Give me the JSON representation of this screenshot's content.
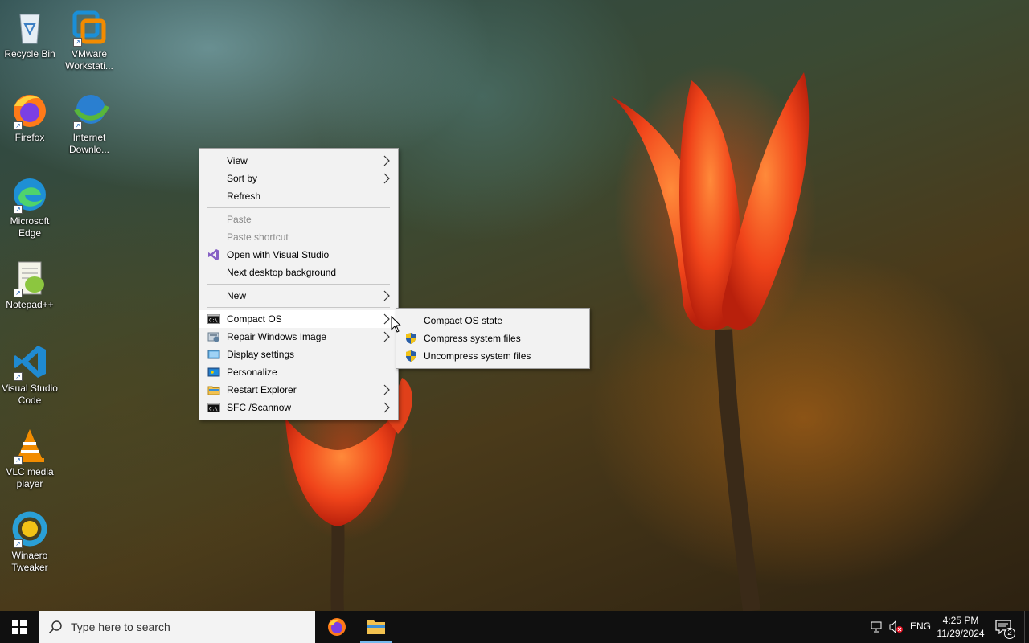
{
  "desktop": {
    "icons": [
      {
        "label": "Recycle Bin",
        "icon": "recycle-bin-icon"
      },
      {
        "label": "VMware Workstati...",
        "icon": "vmware-icon"
      },
      {
        "label": "Firefox",
        "icon": "firefox-icon"
      },
      {
        "label": "Internet Downlo...",
        "icon": "internet-download-manager-icon"
      },
      {
        "label": "Microsoft Edge",
        "icon": "edge-icon"
      },
      {
        "label": "Notepad++",
        "icon": "notepad-plus-plus-icon"
      },
      {
        "label": "Visual Studio Code",
        "icon": "vscode-icon"
      },
      {
        "label": "VLC media player",
        "icon": "vlc-icon"
      },
      {
        "label": "Winaero Tweaker",
        "icon": "winaero-tweaker-icon"
      }
    ]
  },
  "context_menu": {
    "items": [
      {
        "label": "View",
        "submenu": true
      },
      {
        "label": "Sort by",
        "submenu": true
      },
      {
        "label": "Refresh"
      },
      {
        "label": "Paste",
        "disabled": true
      },
      {
        "label": "Paste shortcut",
        "disabled": true
      },
      {
        "label": "Open with Visual Studio",
        "icon": "visual-studio-icon"
      },
      {
        "label": "Next desktop background"
      },
      {
        "label": "New",
        "submenu": true
      },
      {
        "label": "Compact OS",
        "icon": "console-icon",
        "submenu": true,
        "highlighted": true
      },
      {
        "label": "Repair Windows Image",
        "icon": "repair-icon",
        "submenu": true
      },
      {
        "label": "Display settings",
        "icon": "display-icon"
      },
      {
        "label": "Personalize",
        "icon": "personalize-icon"
      },
      {
        "label": "Restart Explorer",
        "icon": "folder-icon",
        "submenu": true
      },
      {
        "label": "SFC /Scannow",
        "icon": "console-icon",
        "submenu": true
      }
    ]
  },
  "submenu": {
    "items": [
      {
        "label": "Compact OS state"
      },
      {
        "label": "Compress system files",
        "icon": "uac-shield-icon"
      },
      {
        "label": "Uncompress system files",
        "icon": "uac-shield-icon"
      }
    ]
  },
  "taskbar": {
    "search_placeholder": "Type here to search",
    "pinned": [
      {
        "name": "Firefox",
        "icon": "firefox-icon"
      },
      {
        "name": "File Explorer",
        "icon": "file-explorer-icon"
      }
    ],
    "language": "ENG",
    "time": "4:25 PM",
    "date": "11/29/2024",
    "notification_count": "2"
  },
  "colors": {
    "taskbar_bg": "#101010",
    "menu_bg": "#f2f2f2",
    "menu_hover": "#ffffff",
    "disabled_text": "#8a8a8a"
  }
}
